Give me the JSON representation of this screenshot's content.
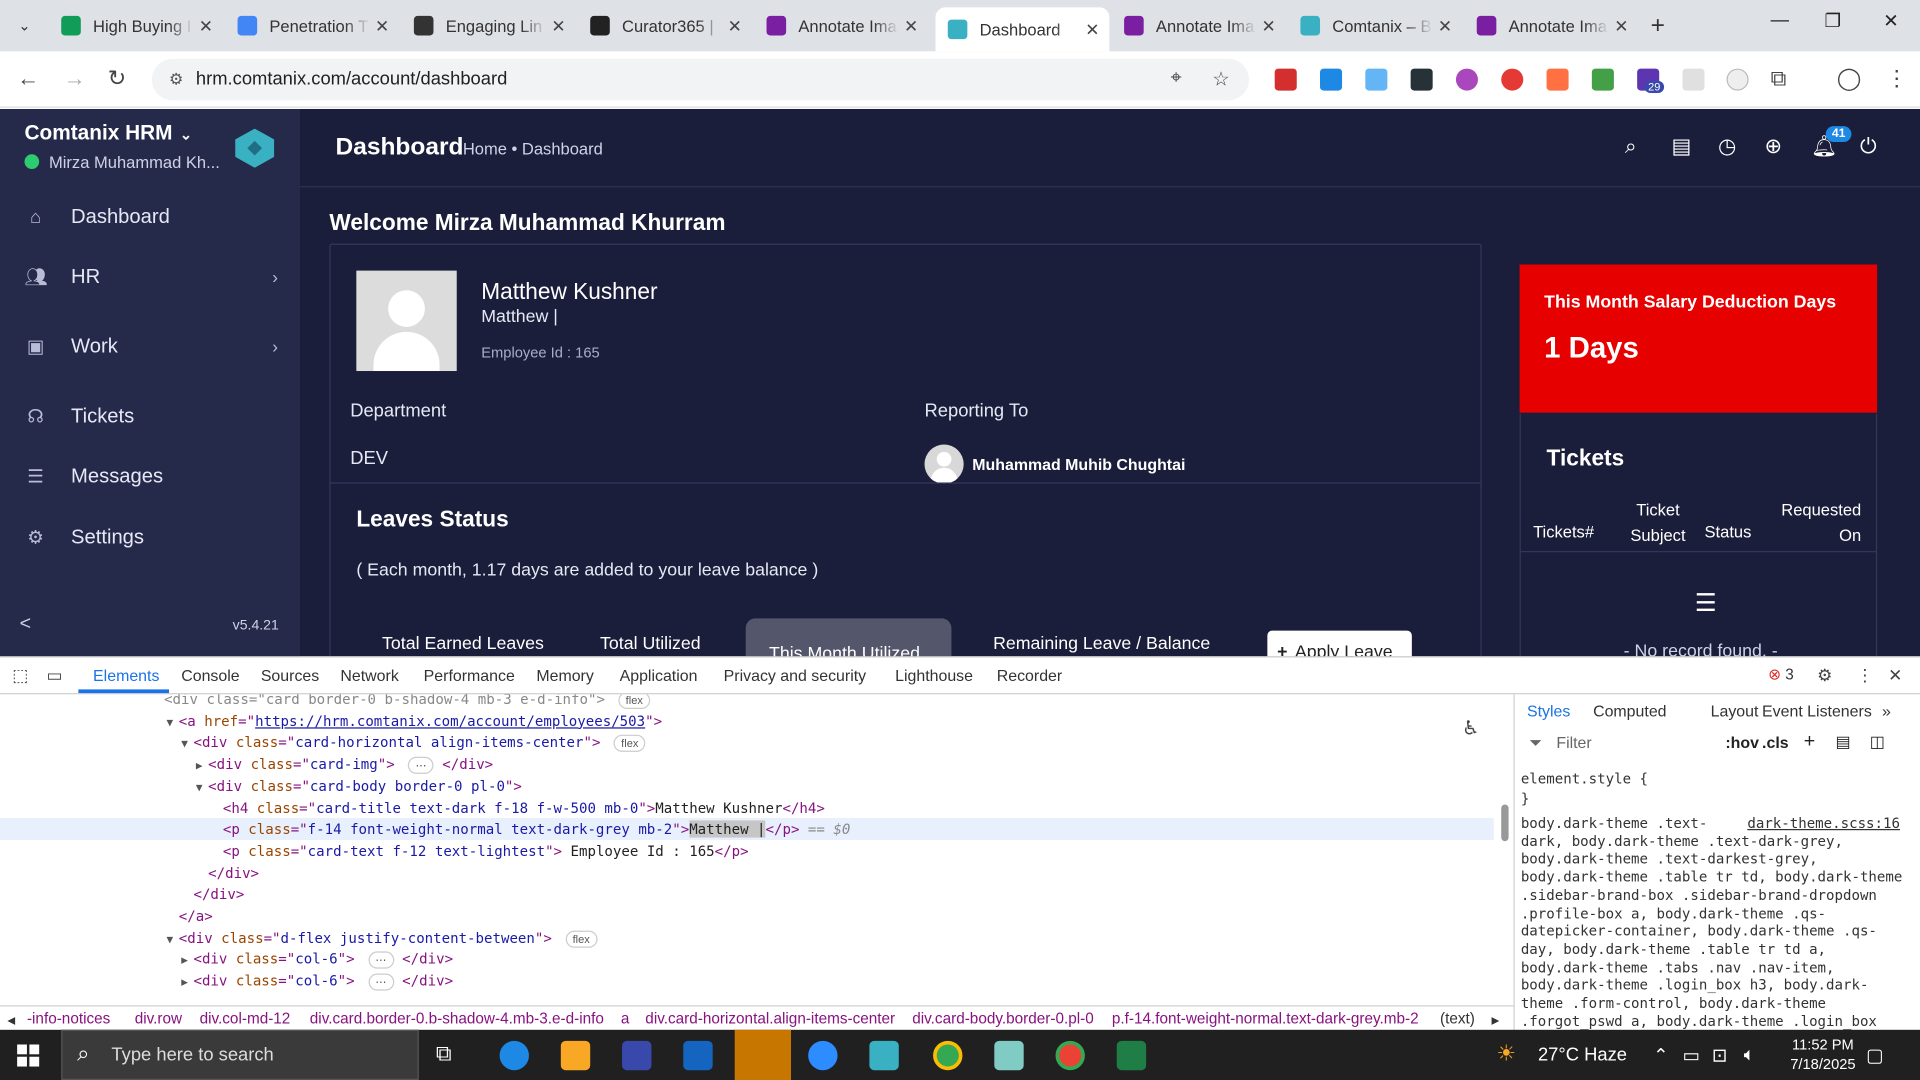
{
  "browser": {
    "tabs": [
      {
        "title": "High Buying I",
        "icon_color": "#0f9d58",
        "icon": "sheets-icon"
      },
      {
        "title": "Penetration T",
        "icon_color": "#4285f4",
        "icon": "docs-icon"
      },
      {
        "title": "Engaging Lin",
        "icon_color": "#333333",
        "icon": "chatgpt-icon"
      },
      {
        "title": "Curator365 |",
        "icon_color": "#222222",
        "icon": "curator-icon"
      },
      {
        "title": "Annotate Ima",
        "icon_color": "#7b1fa2",
        "icon": "annotate-icon"
      },
      {
        "title": "Dashboard",
        "icon_color": "#3ab0c3",
        "icon": "comtanix-icon",
        "active": true
      },
      {
        "title": "Annotate Ima",
        "icon_color": "#7b1fa2",
        "icon": "annotate-icon"
      },
      {
        "title": "Comtanix – B",
        "icon_color": "#3ab0c3",
        "icon": "comtanix-icon"
      },
      {
        "title": "Annotate Ima",
        "icon_color": "#7b1fa2",
        "icon": "annotate-icon"
      }
    ],
    "url": "hrm.comtanix.com/account/dashboard",
    "extension_badge": "29"
  },
  "app": {
    "brand": "Comtanix HRM",
    "user": "Mirza Muhammad Kh...",
    "version": "v5.4.21",
    "nav": [
      {
        "label": "Dashboard",
        "icon": "home-icon",
        "has_arrow": false
      },
      {
        "label": "HR",
        "icon": "users-icon",
        "has_arrow": true
      },
      {
        "label": "Work",
        "icon": "briefcase-icon",
        "has_arrow": true
      },
      {
        "label": "Tickets",
        "icon": "headset-icon",
        "has_arrow": false
      },
      {
        "label": "Messages",
        "icon": "messages-icon",
        "has_arrow": false
      },
      {
        "label": "Settings",
        "icon": "settings-icon",
        "has_arrow": false
      }
    ],
    "page_title": "Dashboard",
    "breadcrumb": "Home • Dashboard",
    "notification_count": "41",
    "welcome": "Welcome Mirza Muhammad Khurram",
    "employee": {
      "name": "Matthew Kushner",
      "subtitle": "Matthew |",
      "id_label": "Employee Id : 165"
    },
    "department_label": "Department",
    "department_value": "DEV",
    "reporting_label": "Reporting To",
    "reporting_name": "Muhammad Muhib Chughtai",
    "leaves": {
      "title": "Leaves Status",
      "note": "( Each month, 1.17 days are added to your leave balance )",
      "columns": [
        "Total Earned Leaves",
        "Total Utilized",
        "This Month Utilized",
        "Remaining Leave / Balance"
      ],
      "apply_label": "Apply Leave"
    },
    "salary": {
      "title": "This Month Salary Deduction Days",
      "value": "1 Days"
    },
    "tickets": {
      "title": "Tickets",
      "headers": [
        "Tickets#",
        "Ticket Subject",
        "Status",
        "Requested On"
      ],
      "empty": "- No record found. -"
    }
  },
  "devtools": {
    "tabs": [
      "Elements",
      "Console",
      "Sources",
      "Network",
      "Performance",
      "Memory",
      "Application",
      "Privacy and security",
      "Lighthouse",
      "Recorder"
    ],
    "error_count": "3",
    "dom_lines": [
      {
        "indent": 0,
        "tw": "",
        "html": "<span class='dsel'>&lt;div class=\"card border-0 b-shadow-4 mb-3 e-d-info\"&gt;</span> <span class='fb'>flex</span>"
      },
      {
        "indent": 1,
        "tw": "▼",
        "html": "&lt;a <span class='an'>href</span>=\"<span class='lk'>https://hrm.comtanix.com/account/employees/503</span>\"&gt;"
      },
      {
        "indent": 2,
        "tw": "▼",
        "html": "&lt;div <span class='an'>class</span>=\"<span class='av'>card-horizontal align-items-center</span>\"&gt; <span class='fb'>flex</span>"
      },
      {
        "indent": 3,
        "tw": "▶",
        "html": "&lt;div <span class='an'>class</span>=\"<span class='av'>card-img</span>\"&gt; <span class='fb'>⋯</span> &lt;/div&gt;"
      },
      {
        "indent": 3,
        "tw": "▼",
        "html": "&lt;div <span class='an'>class</span>=\"<span class='av'>card-body border-0 pl-0</span>\"&gt;"
      },
      {
        "indent": 4,
        "tw": "",
        "html": "&lt;h4 <span class='an'>class</span>=\"<span class='av'>card-title text-dark f-18 f-w-500 mb-0</span>\"&gt;<span class='tx'>Matthew Kushner</span>&lt;/h4&gt;"
      },
      {
        "indent": 4,
        "tw": "",
        "sel": true,
        "html": "&lt;p <span class='an'>class</span>=\"<span class='av'>f-14 font-weight-normal text-dark-grey mb-2</span>\"&gt;<span class='tx hlt'>Matthew |</span>&lt;/p&gt; <span style='color:#888;font-style:italic'>== $0</span>"
      },
      {
        "indent": 4,
        "tw": "",
        "html": "&lt;p <span class='an'>class</span>=\"<span class='av'>card-text f-12 text-lightest</span>\"&gt;<span class='tx'> Employee Id : 165</span>&lt;/p&gt;"
      },
      {
        "indent": 3,
        "tw": "",
        "html": "&lt;/div&gt;"
      },
      {
        "indent": 2,
        "tw": "",
        "html": "&lt;/div&gt;"
      },
      {
        "indent": 1,
        "tw": "",
        "html": "&lt;/a&gt;"
      },
      {
        "indent": 1,
        "tw": "▼",
        "html": "&lt;div <span class='an'>class</span>=\"<span class='av'>d-flex justify-content-between</span>\"&gt; <span class='fb'>flex</span>"
      },
      {
        "indent": 2,
        "tw": "▶",
        "html": "&lt;div <span class='an'>class</span>=\"<span class='av'>col-6</span>\"&gt; <span class='fb'>⋯</span> &lt;/div&gt;"
      },
      {
        "indent": 2,
        "tw": "▶",
        "html": "&lt;div <span class='an'>class</span>=\"<span class='av'>col-6</span>\"&gt; <span class='fb'>⋯</span> &lt;/div&gt;"
      },
      {
        "indent": 1,
        "tw": "",
        "html": "&lt;/div&gt;"
      }
    ],
    "styles_tabs": [
      "Styles",
      "Computed",
      "Layout",
      "Event Listeners"
    ],
    "filter_placeholder": "Filter",
    "hov_label": ":hov",
    "cls_label": ".cls",
    "style_lines": [
      "element.style {",
      "}",
      "body.dark-theme .text-",
      "dark, body.dark-theme .text-dark-grey,",
      "body.dark-theme .text-darkest-grey,",
      "body.dark-theme .table tr td, body.dark-theme",
      ".sidebar-brand-box .sidebar-brand-dropdown",
      ".profile-box a, body.dark-theme .qs-",
      "datepicker-container, body.dark-theme .qs-",
      "day, body.dark-theme .table tr td a,",
      "body.dark-theme .tabs .nav .nav-item,",
      "body.dark-theme .login_box h3, body.dark-",
      "theme .form-control, body.dark-theme",
      ".forgot_pswd a, body.dark-theme .login_box"
    ],
    "style_source": "dark-theme.scss:16",
    "breadcrumbs": [
      "-info-notices",
      "div.row",
      "div.col-md-12",
      "div.card.border-0.b-shadow-4.mb-3.e-d-info",
      "a",
      "div.card-horizontal.align-items-center",
      "div.card-body.border-0.pl-0",
      "p.f-14.font-weight-normal.text-dark-grey.mb-2",
      "(text)"
    ]
  },
  "taskbar": {
    "search_placeholder": "Type here to search",
    "weather": "27°C  Haze",
    "time": "11:52 PM",
    "date": "7/18/2025"
  }
}
